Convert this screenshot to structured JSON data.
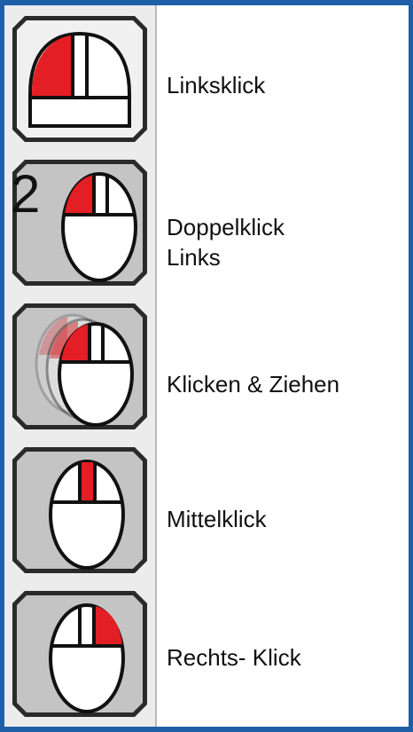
{
  "colors": {
    "accent": "#e31e24",
    "frame": "#1f5fa8",
    "button": "#c4c4c4"
  },
  "tools": [
    {
      "id": "left-click",
      "label": "Linksklick",
      "active_part": "left",
      "icon": "mouse-left-click-icon"
    },
    {
      "id": "double-click-left",
      "label_lines": [
        "Doppelklick",
        "Links"
      ],
      "badge": "2",
      "active_part": "left",
      "icon": "mouse-double-click-icon"
    },
    {
      "id": "click-drag",
      "label": "Klicken & Ziehen",
      "active_part": "left",
      "icon": "mouse-drag-icon"
    },
    {
      "id": "middle-click",
      "label": "Mittelklick",
      "active_part": "middle",
      "icon": "mouse-middle-click-icon"
    },
    {
      "id": "right-click",
      "label": "Rechts- Klick",
      "active_part": "right",
      "icon": "mouse-right-click-icon"
    }
  ]
}
